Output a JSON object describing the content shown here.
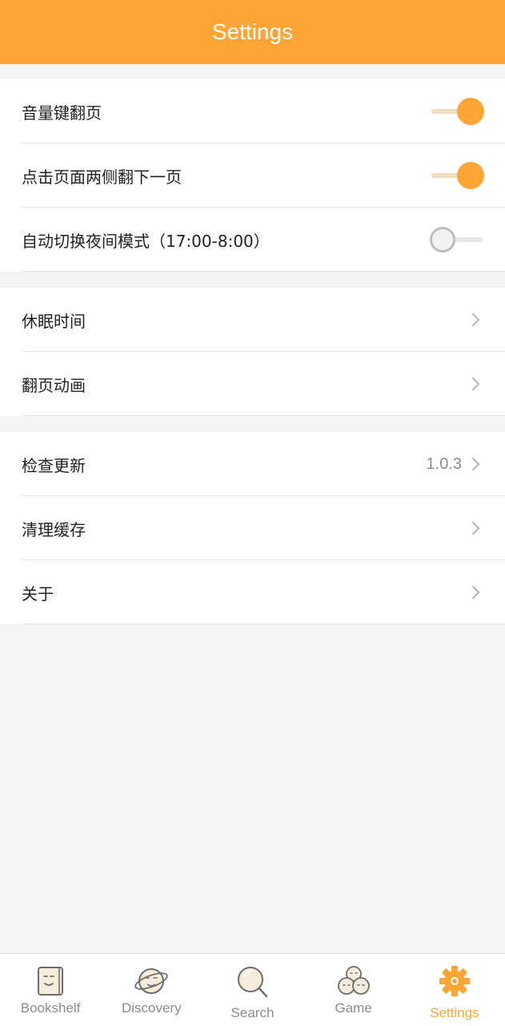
{
  "header": {
    "title": "Settings"
  },
  "group1": [
    {
      "label": "音量键翻页",
      "toggle": true
    },
    {
      "label": "点击页面两侧翻下一页",
      "toggle": true
    },
    {
      "label": "自动切换夜间模式（17:00-8:00）",
      "toggle": false
    }
  ],
  "group2": [
    {
      "label": "休眠时间"
    },
    {
      "label": "翻页动画"
    }
  ],
  "group3": [
    {
      "label": "检查更新",
      "value": "1.0.3"
    },
    {
      "label": "清理缓存"
    },
    {
      "label": "关于"
    }
  ],
  "tabs": [
    {
      "label": "Bookshelf",
      "icon": "bookshelf-icon"
    },
    {
      "label": "Discovery",
      "icon": "planet-icon"
    },
    {
      "label": "Search",
      "icon": "magnifier-icon"
    },
    {
      "label": "Game",
      "icon": "game-faces-icon"
    },
    {
      "label": "Settings",
      "icon": "gear-icon"
    }
  ],
  "colors": {
    "accent": "#ffa535",
    "background": "#f4f4f6"
  }
}
